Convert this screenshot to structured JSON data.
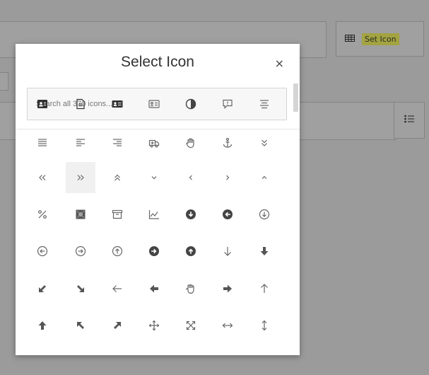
{
  "background": {
    "set_icon_label": "Set Icon"
  },
  "modal": {
    "title": "Select Icon",
    "close_label": "×",
    "search": {
      "placeholder": "Search all 370 icons..."
    },
    "rows": [
      [
        "id-card-icon",
        "file-alt-icon",
        "address-card-icon",
        "id-card-outline-icon",
        "adjust-icon",
        "comment-exclamation-icon",
        "align-center-icon"
      ],
      [
        "align-justify-icon",
        "align-left-icon",
        "align-right-icon",
        "ambulance-icon",
        "hand-paper-icon",
        "anchor-icon",
        "angle-double-down-icon"
      ],
      [
        "angle-double-left-icon",
        "angle-double-right-icon",
        "angle-double-up-icon",
        "angle-down-icon",
        "angle-left-icon",
        "angle-right-icon",
        "angle-up-icon"
      ],
      [
        "percent-icon",
        "archive-pattern-icon",
        "archive-icon",
        "chart-area-icon",
        "arrow-circle-down-icon",
        "arrow-circle-left-icon",
        "arrow-circle-down-outline-icon"
      ],
      [
        "arrow-circle-left-outline-icon",
        "arrow-circle-right-outline-icon",
        "arrow-circle-up-outline-icon",
        "arrow-circle-right-icon",
        "arrow-circle-up-icon",
        "arrow-down-icon",
        "arrow-down-bold-icon"
      ],
      [
        "arrow-down-left-icon",
        "arrow-down-right-icon",
        "arrow-left-icon",
        "arrow-left-bold-icon",
        "hand-rock-icon",
        "arrow-right-bold-icon",
        "arrow-up-icon"
      ],
      [
        "arrow-up-bold-icon",
        "arrow-up-left-icon",
        "arrow-up-right-icon",
        "arrows-move-icon",
        "arrows-expand-icon",
        "arrows-horizontal-icon",
        "arrows-vertical-icon"
      ]
    ]
  }
}
